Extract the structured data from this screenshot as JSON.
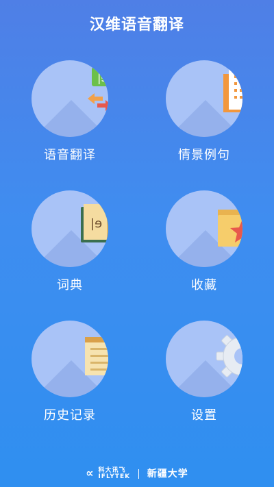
{
  "app": {
    "title": "汉维语音翻译"
  },
  "menu": [
    {
      "label": "语音翻译",
      "icon": "speech-translate-icon"
    },
    {
      "label": "情景例句",
      "icon": "document-list-icon"
    },
    {
      "label": "词典",
      "icon": "dictionary-book-icon"
    },
    {
      "label": "收藏",
      "icon": "favorite-folder-icon"
    },
    {
      "label": "历史记录",
      "icon": "history-notes-icon"
    },
    {
      "label": "设置",
      "icon": "settings-gear-icon"
    }
  ],
  "footer": {
    "brand_cn": "科大讯飞",
    "brand_en": "IFLYTEK",
    "partner": "新疆大学"
  },
  "colors": {
    "bg_top": "#4f7fe6",
    "bg_bottom": "#2f8ff0",
    "circle": "#a9c3f7"
  }
}
